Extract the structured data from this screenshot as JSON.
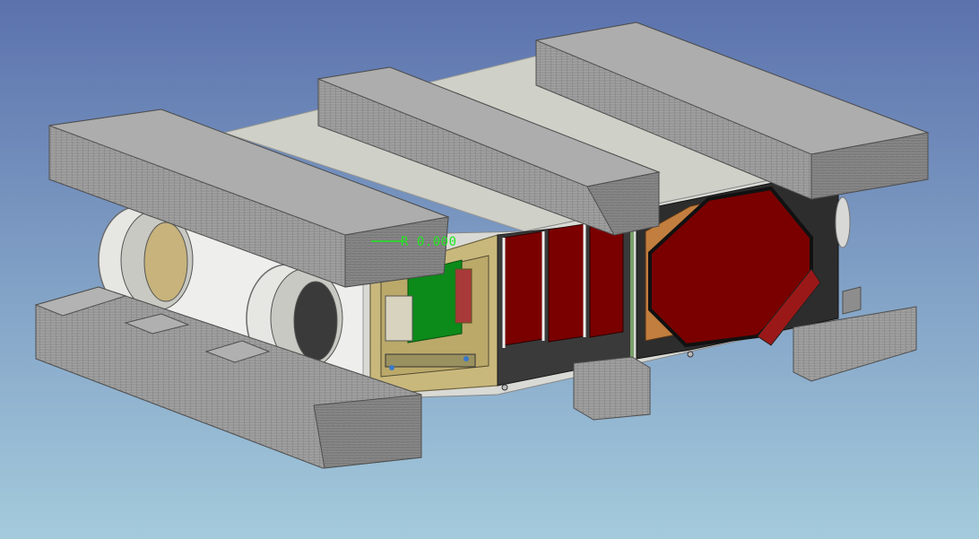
{
  "viewport": {
    "background_top": "#5b72ad",
    "background_bottom": "#a4cbdc"
  },
  "annotation": {
    "text": "R 0.000",
    "color": "#1fe81f"
  },
  "colors": {
    "foam": "#9a9a9a",
    "foam_dark": "#6c6c6c",
    "housing": "#cfd0c8",
    "housing_side": "#e8e8e4",
    "filter_red": "#7a0000",
    "pcb_green": "#0c8a1a",
    "panel_yellow": "#c9b87c",
    "frame_dark": "#2f2f2f"
  }
}
